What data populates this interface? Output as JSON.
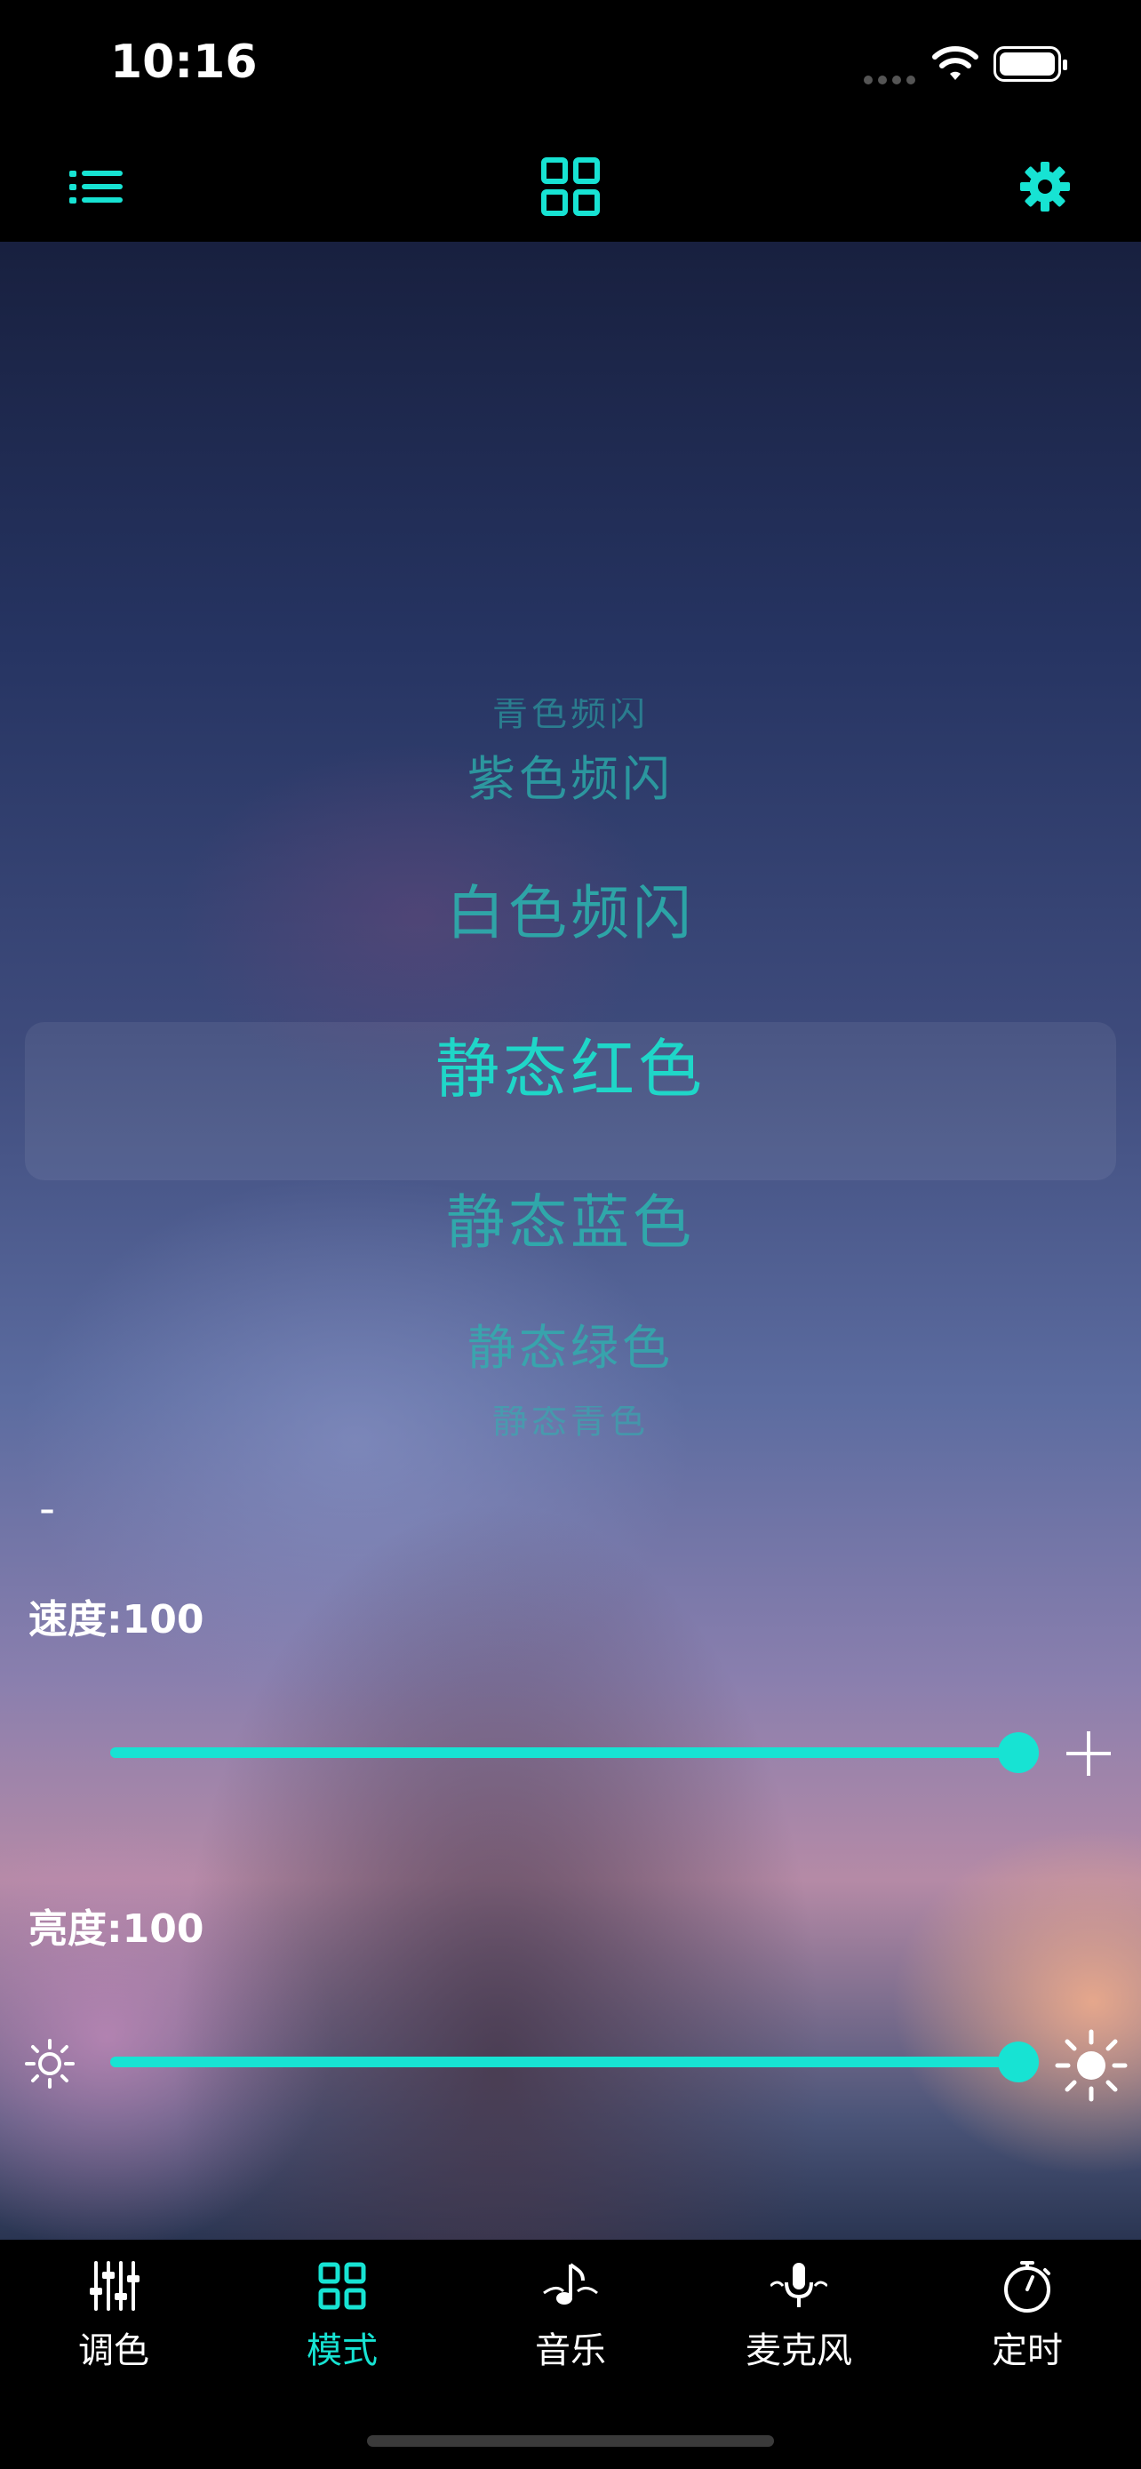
{
  "status_bar": {
    "time": "10:16"
  },
  "top_bar": {
    "left_icon": "list-icon",
    "center_icon": "grid-icon",
    "right_icon": "gear-icon"
  },
  "picker": {
    "items": [
      "青色频闪",
      "紫色频闪",
      "白色频闪",
      "静态红色",
      "静态蓝色",
      "静态绿色",
      "静态青色"
    ],
    "selected": "静态红色",
    "selected_index": 3
  },
  "speed": {
    "label": "速度:100",
    "value": 100,
    "max": 100,
    "minus": "-"
  },
  "brightness": {
    "label": "亮度:100",
    "value": 100,
    "max": 100
  },
  "tabs": [
    {
      "label": "调色",
      "icon": "sliders-icon"
    },
    {
      "label": "模式",
      "icon": "grid-icon",
      "active": true
    },
    {
      "label": "音乐",
      "icon": "music-note-icon"
    },
    {
      "label": "麦克风",
      "icon": "microphone-icon"
    },
    {
      "label": "定时",
      "icon": "timer-icon"
    }
  ],
  "colors": {
    "accent": "#17e3d3",
    "picker_text": "#2bb5b0",
    "tab_inactive": "#ffffff"
  }
}
